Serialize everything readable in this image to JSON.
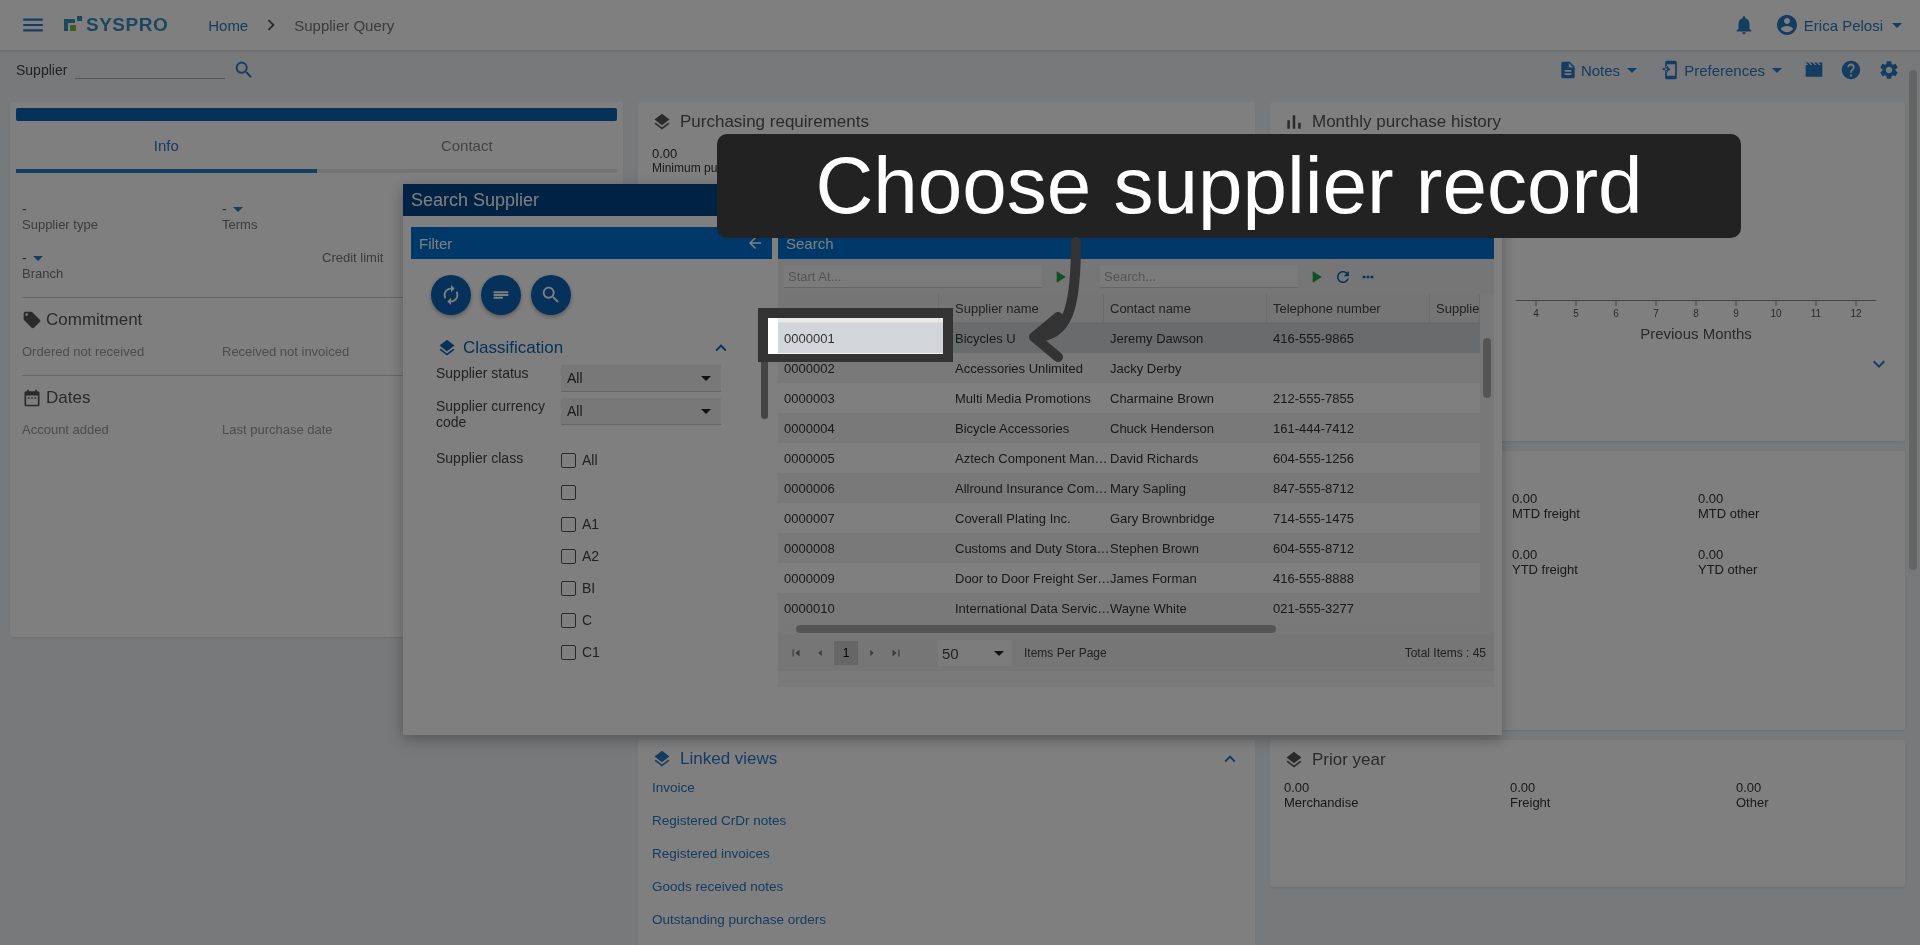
{
  "top_bar": {
    "logo": "SYSPRO",
    "breadcrumbs": [
      "Home",
      "Supplier Query"
    ],
    "user": "Erica Pelosi"
  },
  "toolbar": {
    "field_label": "Supplier",
    "menus": [
      "Notes",
      "Preferences"
    ]
  },
  "info_panel": {
    "tabs": [
      {
        "label": "Info",
        "selected": true
      },
      {
        "label": "Contact",
        "selected": false
      }
    ],
    "fields": [
      {
        "kind": "text",
        "value": "-",
        "label": "Supplier type"
      },
      {
        "kind": "dropdown",
        "value": "-",
        "label": "Terms"
      },
      {
        "kind": "dropdown",
        "value": "-",
        "label": "Branch"
      },
      {
        "kind": "label",
        "label": "Credit limit"
      }
    ],
    "sections": [
      {
        "title": "Commitment",
        "labels": [
          "Ordered not received",
          "Received not invoiced"
        ]
      },
      {
        "title": "Dates",
        "labels": [
          "Account added",
          "Last purchase date"
        ]
      }
    ]
  },
  "purchasing": {
    "title": "Purchasing requirements",
    "fields": [
      {
        "value": "0.00",
        "label": "Minimum pu"
      }
    ]
  },
  "linked_views": {
    "title": "Linked views",
    "links": [
      "Invoice",
      "Registered CrDr notes",
      "Registered invoices",
      "Goods received notes",
      "Outstanding purchase orders"
    ]
  },
  "monthly_history": {
    "title": "Monthly purchase history",
    "x_ticks": [
      "4",
      "5",
      "6",
      "7",
      "8",
      "9",
      "10",
      "11",
      "12"
    ],
    "x_label": "Previous Months"
  },
  "totals_panel": {
    "fields": [
      {
        "value": "0.00",
        "label": "MTD freight"
      },
      {
        "value": "0.00",
        "label": "MTD other"
      },
      {
        "value": "0.00",
        "label": "YTD freight"
      },
      {
        "value": "0.00",
        "label": "YTD other"
      }
    ]
  },
  "prior_year": {
    "title": "Prior year",
    "fields": [
      {
        "value": "0.00",
        "label": "Merchandise"
      },
      {
        "value": "0.00",
        "label": "Freight"
      },
      {
        "value": "0.00",
        "label": "Other"
      }
    ]
  },
  "dialog": {
    "title": "Search Supplier",
    "filter": {
      "title": "Filter",
      "section": "Classification",
      "selects": [
        {
          "label": "Supplier status",
          "value": "All"
        },
        {
          "label": "Supplier currency code",
          "value": "All"
        }
      ],
      "class_label": "Supplier class",
      "classes": [
        {
          "label": "All",
          "checked": false
        },
        {
          "checked": false
        },
        {
          "label": "A1",
          "checked": false
        },
        {
          "label": "A2",
          "checked": false
        },
        {
          "label": "BI",
          "checked": false
        },
        {
          "label": "C",
          "checked": false
        },
        {
          "label": "C1",
          "checked": false
        }
      ]
    },
    "search": {
      "title": "Search",
      "start_placeholder": "Start At...",
      "search_placeholder": "Search...",
      "columns": [
        null,
        "Supplier name",
        "Contact name",
        "Telephone number",
        "Supplie"
      ],
      "rows": [
        {
          "selected": true,
          "cells": [
            "0000001",
            "Bicycles U",
            "Jeremy Dawson",
            "416-555-9865"
          ]
        },
        {
          "selected": false,
          "cells": [
            "0000002",
            "Accessories Unlimited",
            "Jacky Derby",
            null
          ]
        },
        {
          "selected": false,
          "cells": [
            "0000003",
            "Multi Media Promotions",
            "Charmaine Brown",
            "212-555-7855"
          ]
        },
        {
          "selected": false,
          "cells": [
            "0000004",
            "Bicycle Accessories",
            "Chuck Henderson",
            "161-444-7412"
          ]
        },
        {
          "selected": false,
          "cells": [
            "0000005",
            "Aztech Component Man…",
            "David Richards",
            "604-555-1256"
          ]
        },
        {
          "selected": false,
          "cells": [
            "0000006",
            "Allround Insurance Com…",
            "Mary Sapling",
            "847-555-8712"
          ]
        },
        {
          "selected": false,
          "cells": [
            "0000007",
            "Coverall Plating Inc.",
            "Gary Brownbridge",
            "714-555-1475"
          ]
        },
        {
          "selected": false,
          "cells": [
            "0000008",
            "Customs and Duty Stora…",
            "Stephen Brown",
            "604-555-8712"
          ]
        },
        {
          "selected": false,
          "cells": [
            "0000009",
            "Door to Door Freight Ser…",
            "James Forman",
            "416-555-8888"
          ]
        },
        {
          "selected": false,
          "cells": [
            "0000010",
            "International Data Servic…",
            "Wayne White",
            "021-555-3277"
          ]
        }
      ],
      "page": "1",
      "page_size": "50",
      "page_size_label": "Items Per Page",
      "total": "Total Items : 45"
    }
  },
  "callout": {
    "text": "Choose supplier record"
  }
}
